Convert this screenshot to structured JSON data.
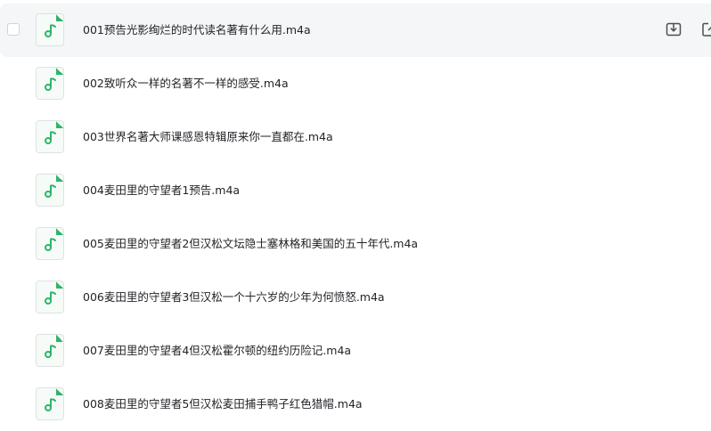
{
  "files": [
    {
      "name": "001预告光影绚烂的时代读名著有什么用.m4a",
      "icon": "music-note-icon",
      "hovered": true
    },
    {
      "name": "002致听众一样的名著不一样的感受.m4a",
      "icon": "music-note-icon"
    },
    {
      "name": "003世界名著大师课感恩特辑原来你一直都在.m4a",
      "icon": "music-note-icon"
    },
    {
      "name": "004麦田里的守望者1预告.m4a",
      "icon": "music-note-icon"
    },
    {
      "name": "005麦田里的守望者2但汉松文坛隐士塞林格和美国的五十年代.m4a",
      "icon": "music-note-icon"
    },
    {
      "name": "006麦田里的守望者3但汉松一个十六岁的少年为何愤怒.m4a",
      "icon": "music-note-icon"
    },
    {
      "name": "007麦田里的守望者4但汉松霍尔顿的纽约历险记.m4a",
      "icon": "music-note-icon"
    },
    {
      "name": "008麦田里的守望者5但汉松麦田捕手鸭子红色猎帽.m4a",
      "icon": "music-note-icon"
    }
  ],
  "row_actions": {
    "download_icon": "download-icon",
    "open_icon": "open-external-icon"
  },
  "colors": {
    "accent": "#2fb46a",
    "hover_background": "#f5f6f7",
    "text": "#222428"
  }
}
